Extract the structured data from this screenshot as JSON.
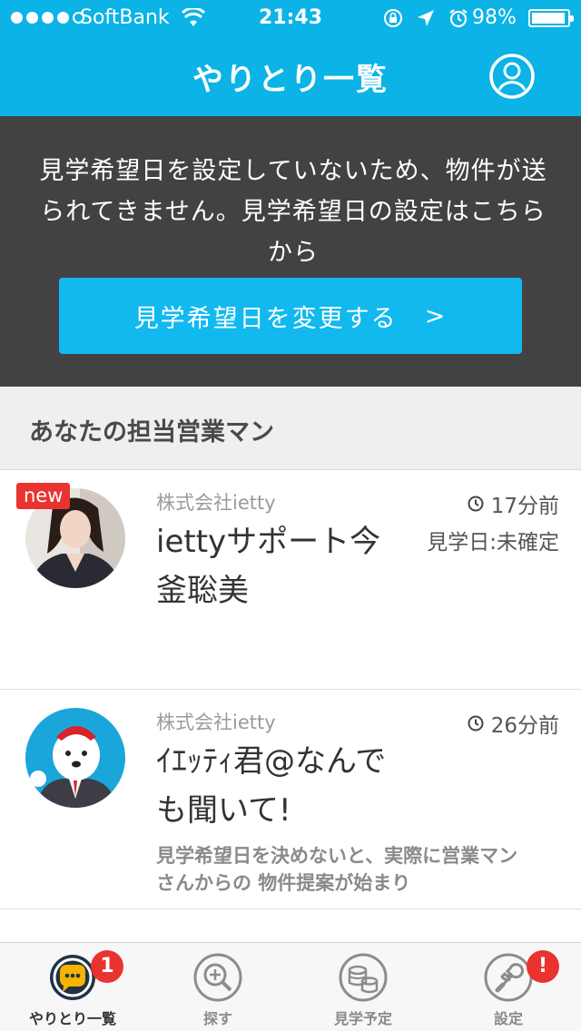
{
  "status_bar": {
    "carrier": "SoftBank",
    "time": "21:43",
    "battery": "98%"
  },
  "header": {
    "title": "やりとり一覧",
    "profile_icon": "user-circle-icon"
  },
  "notice": {
    "message": "見学希望日を設定していないため、物件が送られてきません。見学希望日の設定はこちらから",
    "button_label": "見学希望日を変更する",
    "button_arrow": ">"
  },
  "section": {
    "title": "あなたの担当営業マン"
  },
  "conversations": [
    {
      "badge": "new",
      "company": "株式会社ietty",
      "name": "iettyサポート今釜聡美",
      "time_ago": "17分前",
      "visit_date": "見学日:未確定",
      "preview": ""
    },
    {
      "badge": "",
      "company": "株式会社ietty",
      "name": "ｲｴｯﾃｨ君@なんでも聞いて!",
      "time_ago": "26分前",
      "visit_date": "",
      "preview": "見学希望日を決めないと、実際に営業マンさんからの 物件提案が始まり"
    }
  ],
  "tabbar": {
    "tabs": [
      {
        "label": "やりとり一覧",
        "icon": "chat-bubble-icon",
        "badge": "1",
        "active": true
      },
      {
        "label": "探す",
        "icon": "search-icon",
        "badge": "",
        "active": false
      },
      {
        "label": "見学予定",
        "icon": "coins-icon",
        "badge": "",
        "active": false
      },
      {
        "label": "設定",
        "icon": "wrench-icon",
        "badge": "!",
        "active": false
      }
    ]
  },
  "colors": {
    "accent": "#0bb3e6",
    "banner": "#424242",
    "badge_red": "#e8332f"
  }
}
